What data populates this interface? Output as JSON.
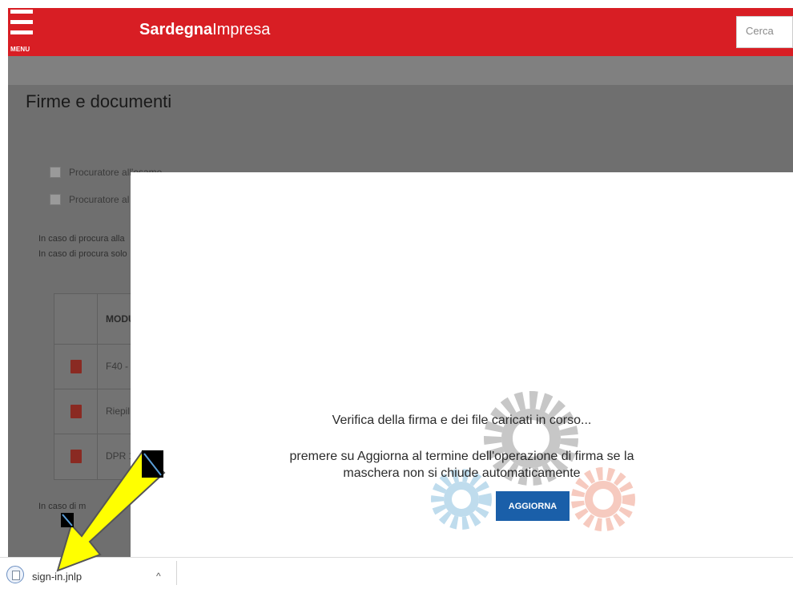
{
  "header": {
    "menu_label": "MENU",
    "brand_bold": "Sardegna",
    "brand_rest": "Impresa",
    "search_placeholder": "Cerca"
  },
  "page": {
    "title": "Firme e documenti",
    "checkboxes": [
      {
        "label": "Procuratore all'esame"
      },
      {
        "label": "Procuratore al"
      }
    ],
    "notes": [
      "In caso di procura alla",
      "In caso di procura solo",
      "In caso di m"
    ],
    "table": {
      "header": "MODU",
      "rows": [
        {
          "name": "F40 -"
        },
        {
          "name": "Riepil"
        },
        {
          "name": "DPR 1"
        }
      ]
    }
  },
  "modal": {
    "line1": "Verifica della firma e dei file caricati in corso...",
    "line2": "premere su Aggiorna al termine dell'operazione di firma se la",
    "line3": "maschera non si chiude automaticamente",
    "button_label": "AGGIORNA"
  },
  "download_bar": {
    "file_name": "sign-in.jnlp",
    "chevron": "^"
  },
  "colors": {
    "brand_red": "#d81e24",
    "button_blue": "#1a5fa9",
    "annotation_yellow": "#ffff00"
  },
  "icons": [
    "menu-icon",
    "pdf-icon",
    "gears-icon",
    "file-icon",
    "chevron-up-icon",
    "arrow-icon"
  ]
}
